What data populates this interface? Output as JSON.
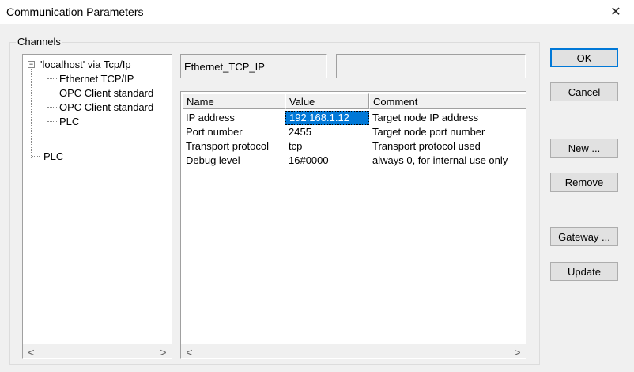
{
  "window": {
    "title": "Communication Parameters",
    "close_glyph": "✕"
  },
  "channels": {
    "group_label": "Channels",
    "tree": [
      {
        "label": "'localhost' via Tcp/Ip",
        "expanded": true
      },
      {
        "label": "Ethernet TCP/IP"
      },
      {
        "label": "OPC Client standard"
      },
      {
        "label": "OPC Client standard"
      },
      {
        "label": "PLC"
      },
      {
        "label": "PLC"
      }
    ]
  },
  "channel_name": "Ethernet_TCP_IP",
  "channel_desc": "",
  "params": {
    "headers": [
      "Name",
      "Value",
      "Comment"
    ],
    "rows": [
      {
        "name": "IP address",
        "value": "192.168.1.12",
        "comment": "Target node IP address"
      },
      {
        "name": "Port number",
        "value": "2455",
        "comment": "Target node port number"
      },
      {
        "name": "Transport protocol",
        "value": "tcp",
        "comment": "Transport protocol used"
      },
      {
        "name": "Debug level",
        "value": "16#0000",
        "comment": "always 0, for internal use only"
      }
    ]
  },
  "buttons": {
    "ok": "OK",
    "cancel": "Cancel",
    "new": "New ...",
    "remove": "Remove",
    "gateway": "Gateway ...",
    "update": "Update"
  },
  "scroll": {
    "left": "<",
    "right": ">"
  },
  "icons": {
    "expander": "−"
  }
}
